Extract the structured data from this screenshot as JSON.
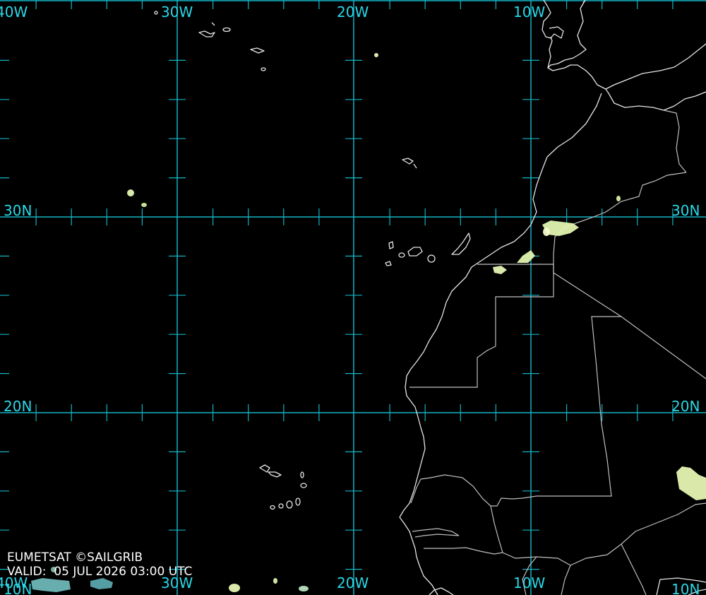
{
  "map": {
    "longitude_labels": [
      "40W",
      "30W",
      "20W",
      "10W"
    ],
    "latitude_labels": [
      "30N",
      "20N",
      "10N"
    ],
    "credit": "EUMETSAT ©SAILGRIB",
    "valid_label": "VALID:  05 JUL 2026 03:00 UTC",
    "colors": {
      "background": "#000000",
      "graticule": "#12b3c4",
      "label": "#2ad7e6",
      "coastline": "#e6e6e6",
      "cloud": "#d8f0b0"
    }
  }
}
